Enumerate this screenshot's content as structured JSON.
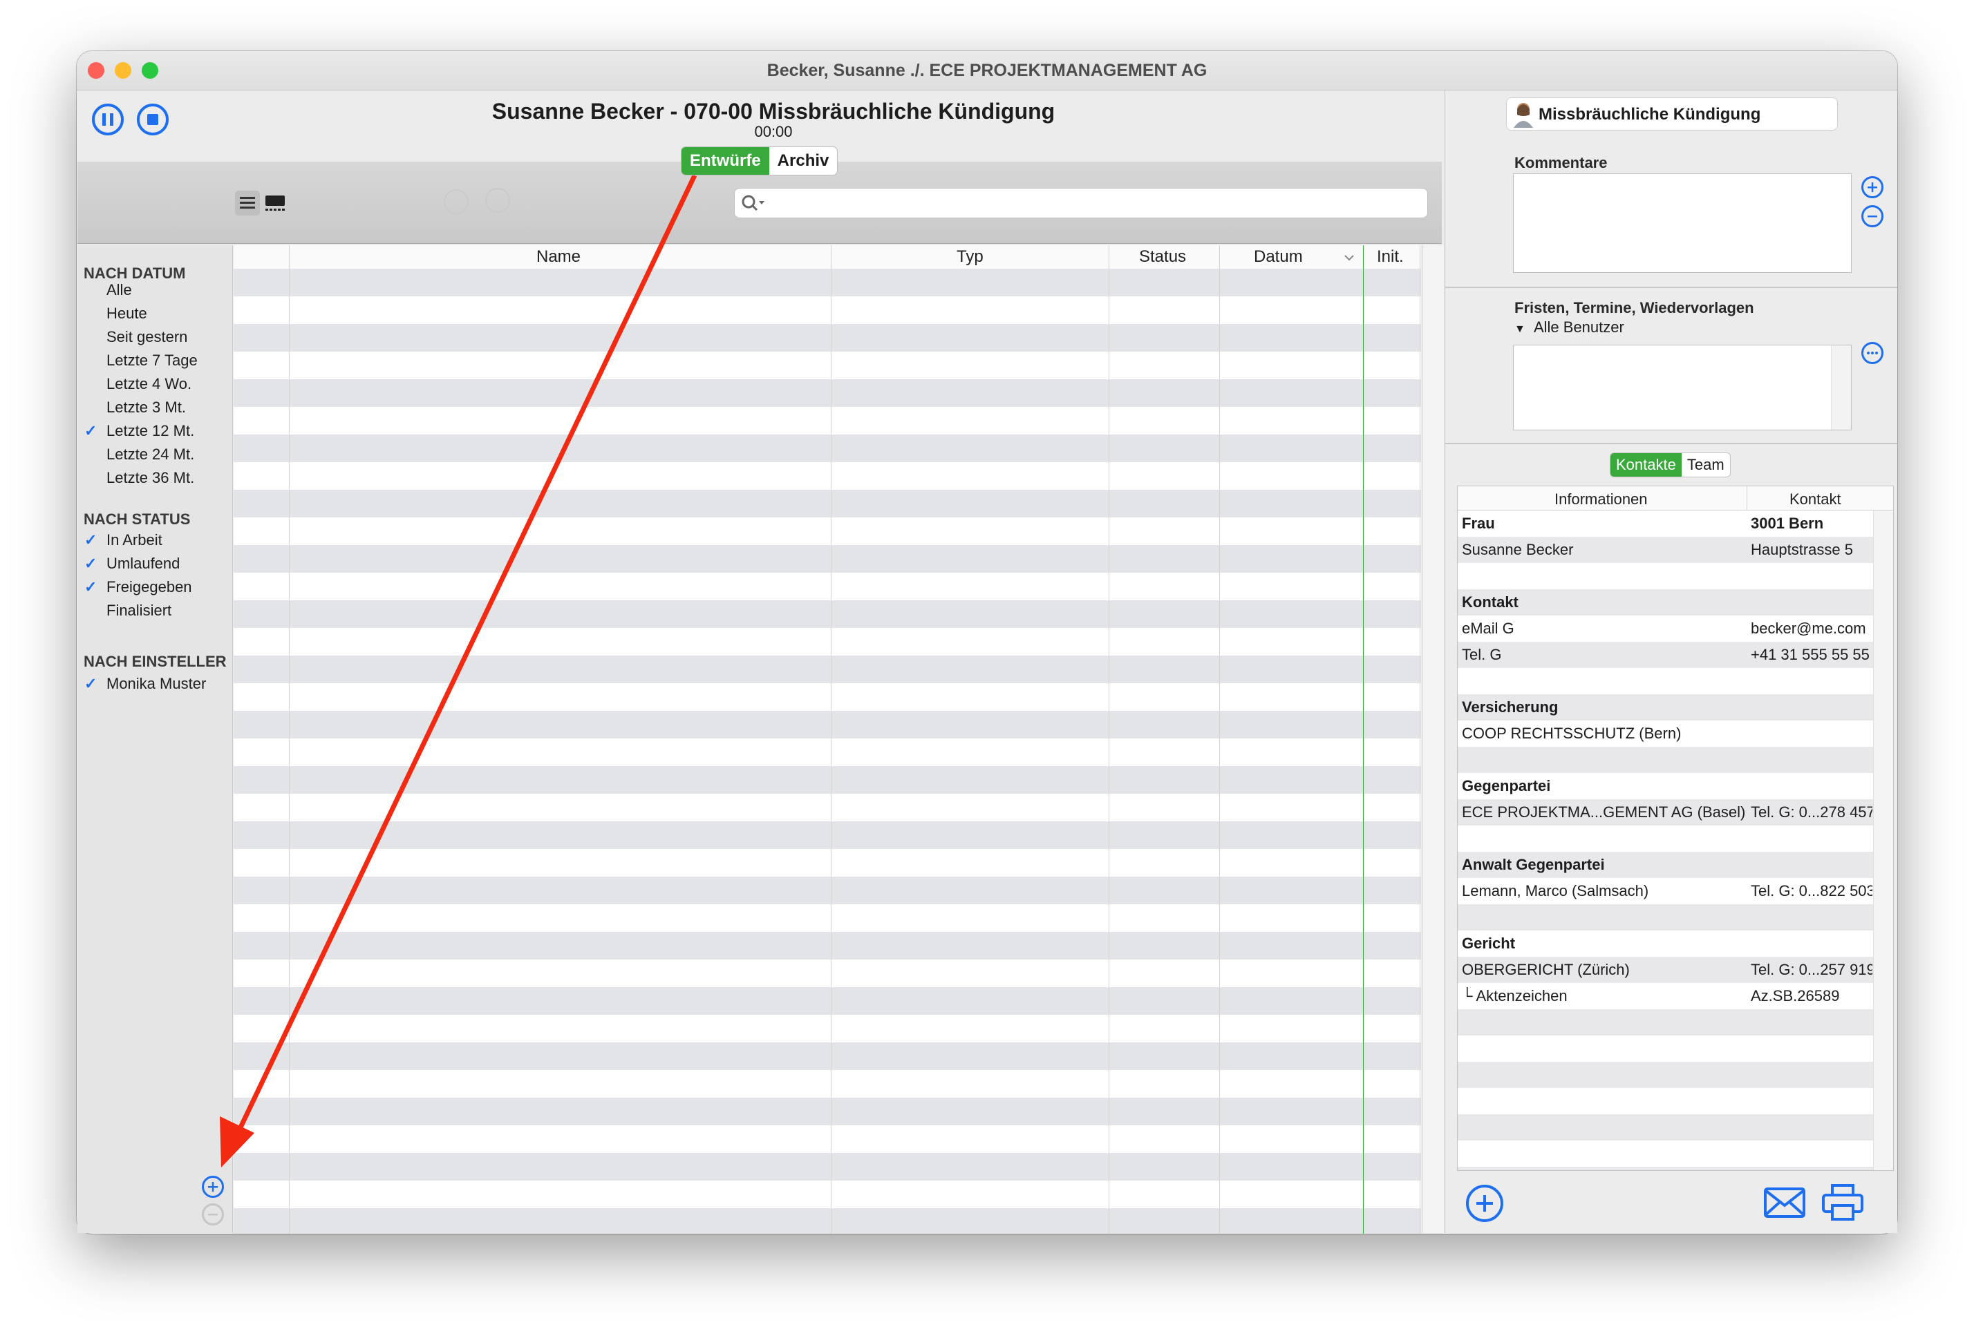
{
  "window": {
    "title": "Becker, Susanne ./. ECE PROJEKTMANAGEMENT AG"
  },
  "header": {
    "case_title": "Susanne Becker - 070-00 Missbräuchliche Kündigung",
    "timer": "00:00",
    "tabs": [
      "Entwürfe",
      "Archiv"
    ]
  },
  "search": {
    "placeholder": ""
  },
  "sidebar": {
    "sections": [
      {
        "title": "NACH DATUM",
        "items": [
          {
            "label": "Alle",
            "checked": false
          },
          {
            "label": "Heute",
            "checked": false
          },
          {
            "label": "Seit gestern",
            "checked": false
          },
          {
            "label": "Letzte 7 Tage",
            "checked": false
          },
          {
            "label": "Letzte 4 Wo.",
            "checked": false
          },
          {
            "label": "Letzte 3 Mt.",
            "checked": false
          },
          {
            "label": "Letzte 12 Mt.",
            "checked": true
          },
          {
            "label": "Letzte 24 Mt.",
            "checked": false
          },
          {
            "label": "Letzte 36 Mt.",
            "checked": false
          }
        ]
      },
      {
        "title": "NACH STATUS",
        "items": [
          {
            "label": "In Arbeit",
            "checked": true
          },
          {
            "label": "Umlaufend",
            "checked": true
          },
          {
            "label": "Freigegeben",
            "checked": true
          },
          {
            "label": "Finalisiert",
            "checked": false
          }
        ]
      },
      {
        "title": "NACH EINSTELLER",
        "items": [
          {
            "label": "Monika Muster",
            "checked": true
          }
        ]
      }
    ]
  },
  "table": {
    "columns": [
      "Name",
      "Typ",
      "Status",
      "Datum",
      "Init."
    ]
  },
  "right": {
    "matter_title": "Missbräuchliche Kündigung",
    "comments_label": "Kommentare",
    "deadlines_label": "Fristen, Termine, Wiedervorlagen",
    "users_filter": "Alle Benutzer",
    "contact_tabs": [
      "Kontakte",
      "Team"
    ],
    "contacts_columns": [
      "Informationen",
      "Kontakt"
    ],
    "contacts": [
      {
        "info": "Frau",
        "contact": "3001 Bern",
        "bold": true
      },
      {
        "info": "Susanne Becker",
        "contact": "Hauptstrasse 5"
      },
      {
        "info": "",
        "contact": ""
      },
      {
        "info": "Kontakt",
        "contact": "",
        "bold": true
      },
      {
        "info": "eMail G",
        "contact": "becker@me.com"
      },
      {
        "info": "Tel. G",
        "contact": "+41 31 555 55 55"
      },
      {
        "info": "",
        "contact": ""
      },
      {
        "info": "Versicherung",
        "contact": "",
        "bold": true
      },
      {
        "info": "COOP RECHTSSCHUTZ (Bern)",
        "contact": ""
      },
      {
        "info": "",
        "contact": ""
      },
      {
        "info": "Gegenpartei",
        "contact": "",
        "bold": true
      },
      {
        "info": "ECE PROJEKTMA...GEMENT AG (Basel)",
        "contact": "Tel. G: 0...278 457"
      },
      {
        "info": "",
        "contact": ""
      },
      {
        "info": "Anwalt Gegenpartei",
        "contact": "",
        "bold": true
      },
      {
        "info": "Lemann, Marco (Salmsach)",
        "contact": "Tel. G: 0...822 503"
      },
      {
        "info": "",
        "contact": ""
      },
      {
        "info": "Gericht",
        "contact": "",
        "bold": true
      },
      {
        "info": "OBERGERICHT (Zürich)",
        "contact": "Tel. G: 0...257 919"
      },
      {
        "info": "└ Aktenzeichen",
        "contact": "Az.SB.26589"
      }
    ]
  },
  "colors": {
    "accent": "#1d6ff0",
    "green": "#3aa93b",
    "annotation_arrow": "#f22a12"
  }
}
